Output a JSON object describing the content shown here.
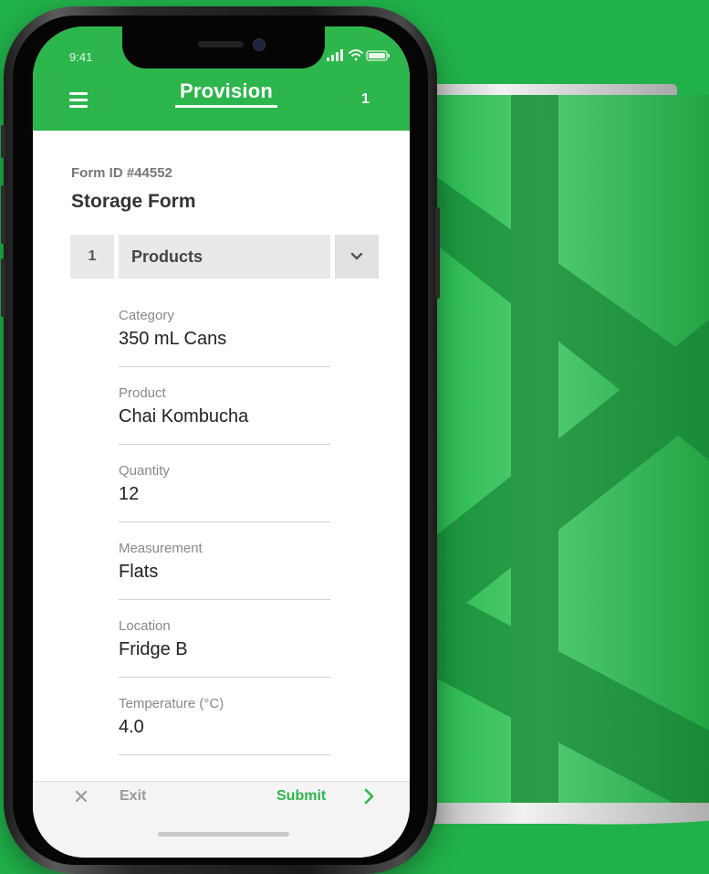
{
  "status_bar": {
    "time": "9:41"
  },
  "app": {
    "title": "Provision",
    "count": "1"
  },
  "form": {
    "id_label": "Form ID #44552",
    "title": "Storage Form"
  },
  "section": {
    "number": "1",
    "title": "Products"
  },
  "fields": [
    {
      "label": "Category",
      "value": "350 mL Cans"
    },
    {
      "label": "Product",
      "value": "Chai Kombucha"
    },
    {
      "label": "Quantity",
      "value": "12"
    },
    {
      "label": "Measurement",
      "value": "Flats"
    },
    {
      "label": "Location",
      "value": "Fridge B"
    },
    {
      "label": "Temperature (°C)",
      "value": "4.0"
    }
  ],
  "bottom_bar": {
    "exit_label": "Exit",
    "submit_label": "Submit"
  },
  "icons": [
    "menu-icon",
    "signal-icon",
    "wifi-icon",
    "battery-icon",
    "chevron-down-icon",
    "close-icon",
    "chevron-right-icon"
  ],
  "colors": {
    "brand_green": "#2db64c",
    "background_green": "#21b14a"
  }
}
